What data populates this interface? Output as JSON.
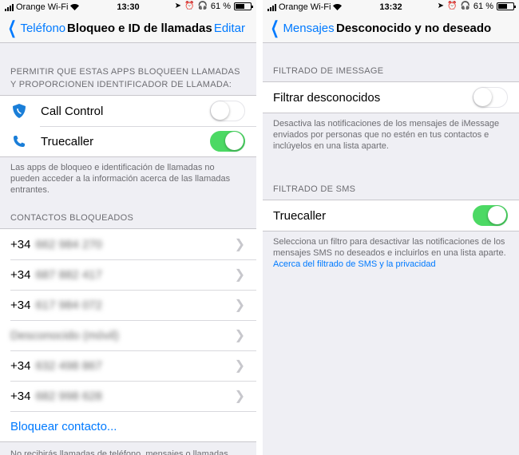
{
  "status": {
    "carrier": "Orange Wi-Fi",
    "battery": "61 %",
    "battery_level": 0.61
  },
  "left": {
    "time": "13:30",
    "nav": {
      "back": "Teléfono",
      "title": "Bloqueo e ID de llamadas",
      "action": "Editar"
    },
    "apps_header": "PERMITIR QUE ESTAS APPS BLOQUEEN LLAMADAS Y PROPORCIONEN IDENTIFICADOR DE LLAMADA:",
    "apps": [
      {
        "name": "Call Control",
        "icon": "shield-icon",
        "enabled": false
      },
      {
        "name": "Truecaller",
        "icon": "phone-icon",
        "enabled": true
      }
    ],
    "apps_footer": "Las apps de bloqueo e identificación de llamadas no pueden acceder a la información acerca de las llamadas entrantes.",
    "blocked_header": "CONTACTOS BLOQUEADOS",
    "blocked": [
      {
        "prefix": "+34",
        "masked": "662 984 270"
      },
      {
        "prefix": "+34",
        "masked": "687 882 417"
      },
      {
        "prefix": "+34",
        "masked": "617 984 072"
      },
      {
        "prefix": "",
        "masked": "Desconocido (móvil)"
      },
      {
        "prefix": "+34",
        "masked": "632 498 867"
      },
      {
        "prefix": "+34",
        "masked": "682 998 628"
      }
    ],
    "block_link": "Bloquear contacto...",
    "bottom_footer": "No recibirás llamadas de teléfono, mensajes o llamadas"
  },
  "right": {
    "time": "13:32",
    "nav": {
      "back": "Mensajes",
      "title": "Desconocido y no deseado"
    },
    "imessage_header": "FILTRADO DE IMESSAGE",
    "imessage_row": {
      "label": "Filtrar desconocidos",
      "enabled": false
    },
    "imessage_footer": "Desactiva las notificaciones de los mensajes de iMessage enviados por personas que no estén en tus contactos e inclúyelos en una lista aparte.",
    "sms_header": "FILTRADO DE SMS",
    "sms_row": {
      "label": "Truecaller",
      "enabled": true
    },
    "sms_footer": "Selecciona un filtro para desactivar las notificaciones de los mensajes SMS no deseados e incluirlos en una lista aparte.",
    "sms_link": "Acerca del filtrado de SMS y la privacidad"
  },
  "colors": {
    "accent": "#007aff",
    "toggle_on": "#4cd964",
    "background": "#efeff4"
  }
}
